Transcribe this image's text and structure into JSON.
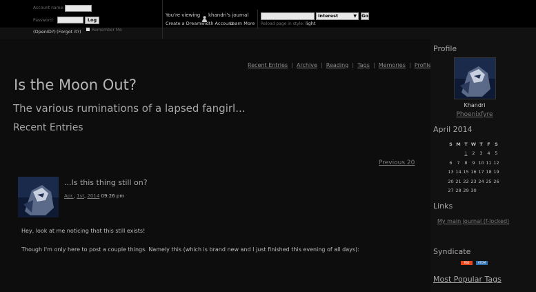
{
  "login": {
    "account_label": "Account name:",
    "password_label": "Password:",
    "login_button": "Log in",
    "openid": "(OpenID?)",
    "forgot": "(Forgot it?)",
    "remember": "Remember Me"
  },
  "viewing": {
    "prefix": "You're viewing",
    "journal": "khandri's journal",
    "create": "Create a Dreamwidth Account",
    "learn": "Learn More"
  },
  "search": {
    "value": "",
    "select_value": "Interest",
    "go": "Go",
    "reload_label": "Reload page in style:",
    "reload_value": "light"
  },
  "journal": {
    "title": "Is the Moon Out?",
    "subtitle": "The various ruminations of a lapsed fangirl...",
    "section": "Recent Entries"
  },
  "nav": [
    "Recent Entries",
    "Archive",
    "Reading",
    "Tags",
    "Memories",
    "Profile"
  ],
  "pager": {
    "previous": "Previous 20"
  },
  "entry": {
    "title": "...Is this thing still on?",
    "date_month": "Apr.",
    "date_day": "1st",
    "date_year": "2014",
    "time": "09:26 pm",
    "para1": "Hey, look at me noticing that this still exists!",
    "para2": "Though I'm only here to post a couple things. Namely this (which is brand new and I just finished this evening of all days):"
  },
  "sidebar": {
    "profile_heading": "Profile",
    "name": "Khandri",
    "link": "Phoenixfyre",
    "calendar_heading": "April 2014",
    "weekdays": [
      "S",
      "M",
      "T",
      "W",
      "T",
      "F",
      "S"
    ],
    "weeks": [
      [
        "",
        "",
        "1",
        "2",
        "3",
        "4",
        "5"
      ],
      [
        "6",
        "7",
        "8",
        "9",
        "10",
        "11",
        "12"
      ],
      [
        "13",
        "14",
        "15",
        "16",
        "17",
        "18",
        "19"
      ],
      [
        "20",
        "21",
        "22",
        "23",
        "24",
        "25",
        "26"
      ],
      [
        "27",
        "28",
        "29",
        "30",
        "",
        "",
        ""
      ]
    ],
    "links_heading": "Links",
    "links": [
      "My main journal (f-locked)"
    ],
    "syndicate_heading": "Syndicate",
    "rss": "RSS",
    "atom": "ATOM",
    "tags_heading": "Most Popular Tags"
  },
  "colors": {
    "background": "#0d0d0d",
    "sidebar": "#111111",
    "text": "#bdbdbd",
    "rss": "#e8471b",
    "atom": "#2d6fb0"
  }
}
